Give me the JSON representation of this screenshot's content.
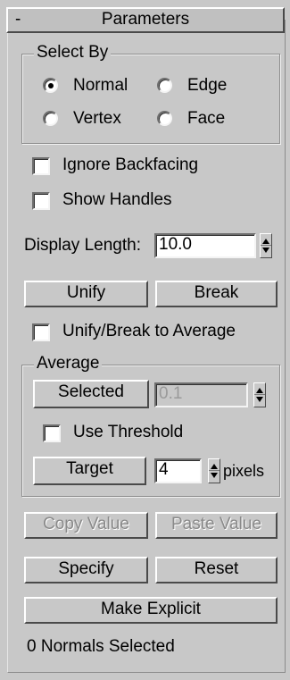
{
  "rollout": {
    "collapse_symbol": "-",
    "title": "Parameters"
  },
  "select_by": {
    "title": "Select By",
    "options": [
      {
        "label": "Normal",
        "selected": true
      },
      {
        "label": "Edge",
        "selected": false
      },
      {
        "label": "Vertex",
        "selected": false
      },
      {
        "label": "Face",
        "selected": false
      }
    ]
  },
  "checks": {
    "ignore_backfacing": {
      "label": "Ignore Backfacing",
      "checked": false
    },
    "show_handles": {
      "label": "Show Handles",
      "checked": false
    },
    "unify_break_average": {
      "label": "Unify/Break to Average",
      "checked": false
    }
  },
  "display_length": {
    "label": "Display Length:",
    "value": "10.0"
  },
  "buttons": {
    "unify": "Unify",
    "break": "Break",
    "copy_value": "Copy Value",
    "paste_value": "Paste Value",
    "specify": "Specify",
    "reset": "Reset",
    "make_explicit": "Make Explicit"
  },
  "average": {
    "title": "Average",
    "selected_button": "Selected",
    "selected_value": "0.1",
    "use_threshold": {
      "label": "Use Threshold",
      "checked": false
    },
    "target_button": "Target",
    "target_value": "4",
    "target_unit": "pixels"
  },
  "status": {
    "text": "0 Normals Selected"
  },
  "colors": {
    "panel_background": "#c8c8c8",
    "disabled_text": "#8a8a8a"
  }
}
